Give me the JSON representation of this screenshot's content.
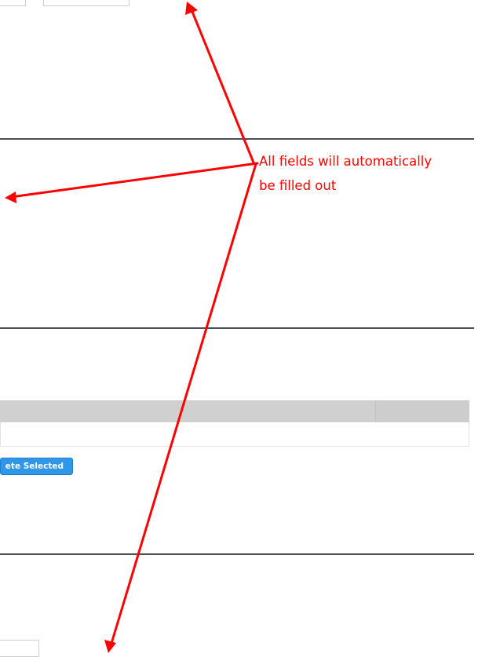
{
  "actions": {
    "delete_selected_label": "ete Selected"
  },
  "annotation": {
    "line1": "All fields will automatically",
    "line2": "be filled out",
    "color": "#ff0000"
  },
  "colors": {
    "divider": "#4a4f59",
    "button": "#2f96e8",
    "table_header": "#d0d0d0"
  }
}
